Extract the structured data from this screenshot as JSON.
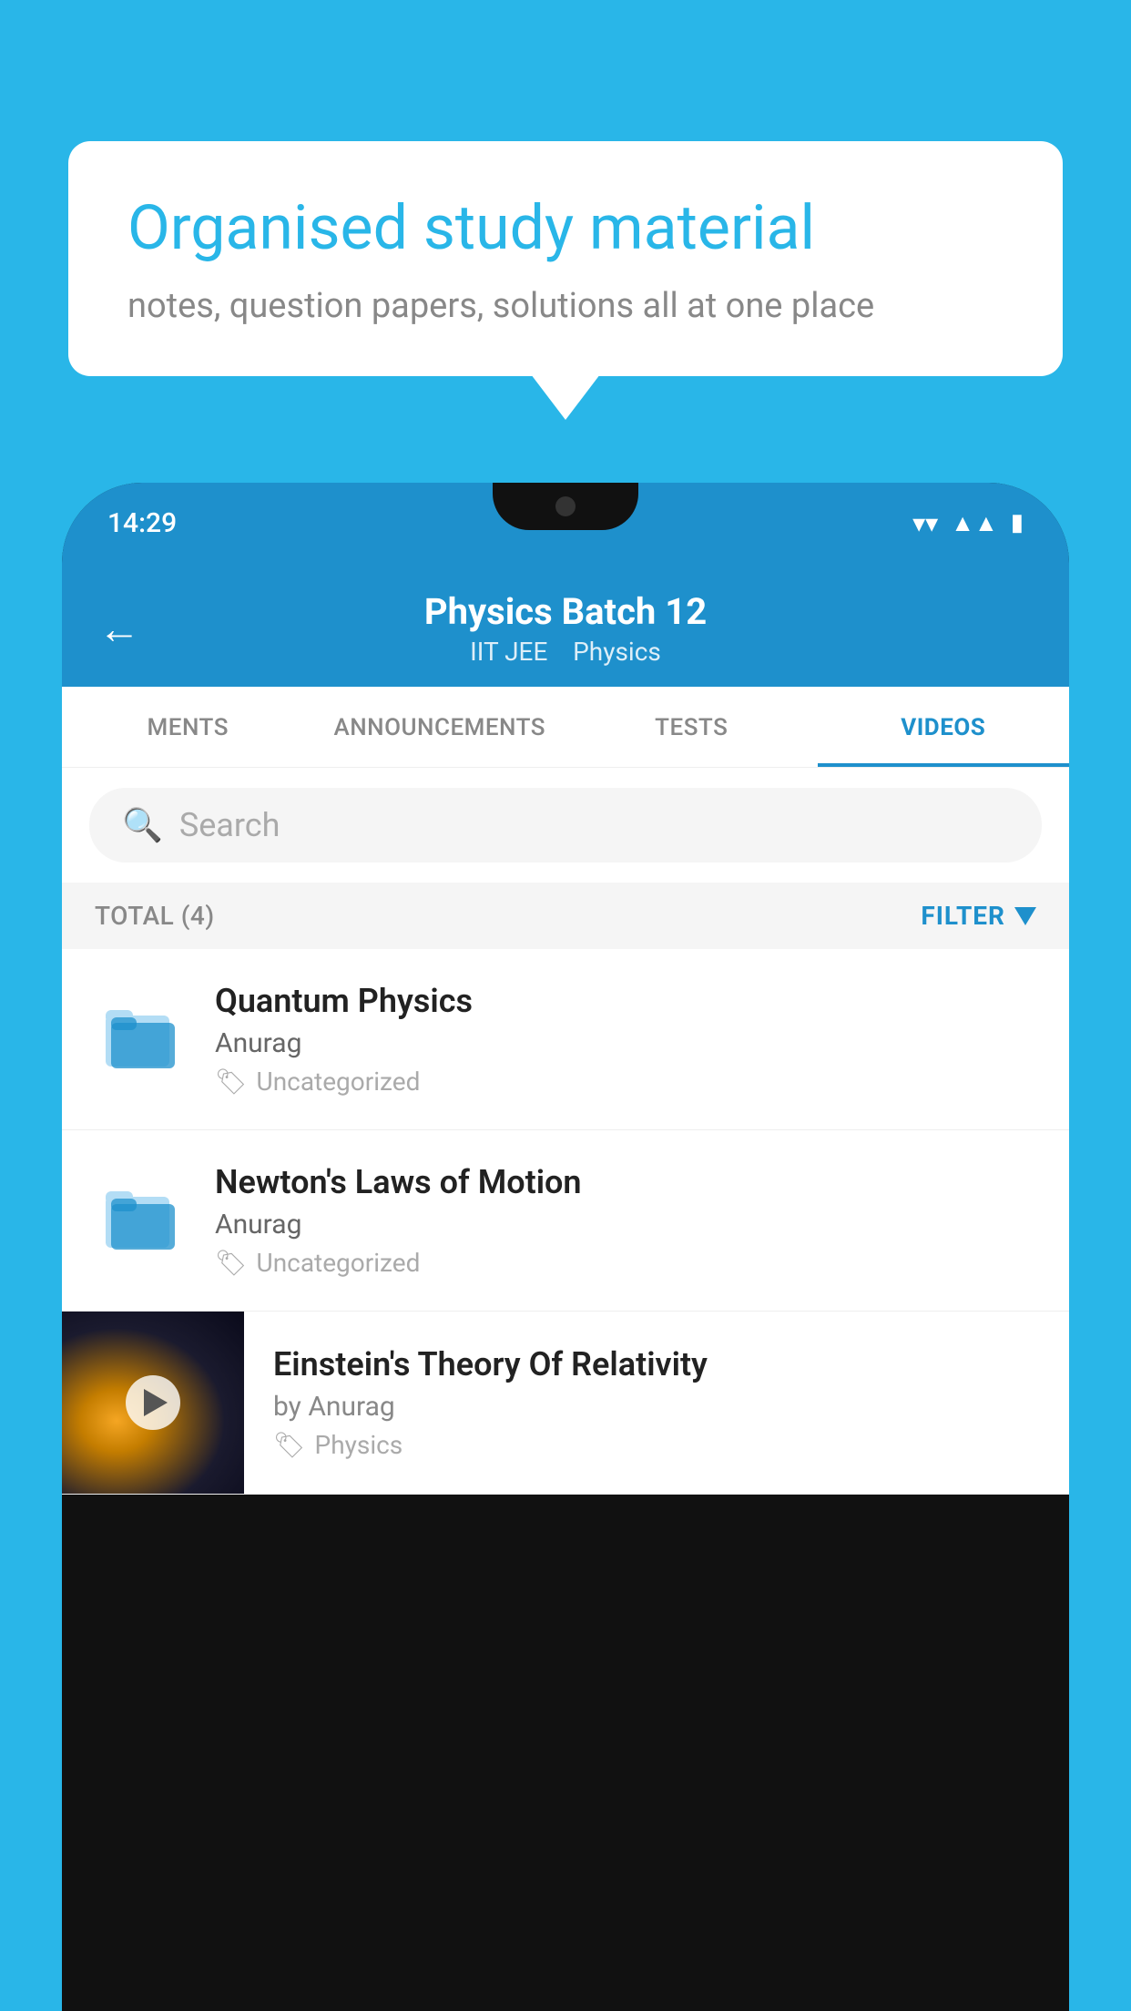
{
  "background_color": "#29b6e8",
  "bubble": {
    "title": "Organised study material",
    "subtitle": "notes, question papers, solutions all at one place"
  },
  "phone": {
    "status_bar": {
      "time": "14:29"
    },
    "header": {
      "title": "Physics Batch 12",
      "subtitle_1": "IIT JEE",
      "subtitle_2": "Physics",
      "back_label": "←"
    },
    "tabs": [
      {
        "label": "MENTS",
        "active": false
      },
      {
        "label": "ANNOUNCEMENTS",
        "active": false
      },
      {
        "label": "TESTS",
        "active": false
      },
      {
        "label": "VIDEOS",
        "active": true
      }
    ],
    "search": {
      "placeholder": "Search"
    },
    "filter_bar": {
      "total_label": "TOTAL (4)",
      "filter_label": "FILTER"
    },
    "videos": [
      {
        "title": "Quantum Physics",
        "author": "Anurag",
        "tag": "Uncategorized",
        "has_thumbnail": false
      },
      {
        "title": "Newton's Laws of Motion",
        "author": "Anurag",
        "tag": "Uncategorized",
        "has_thumbnail": false
      },
      {
        "title": "Einstein's Theory Of Relativity",
        "author": "by Anurag",
        "tag": "Physics",
        "has_thumbnail": true
      }
    ]
  }
}
